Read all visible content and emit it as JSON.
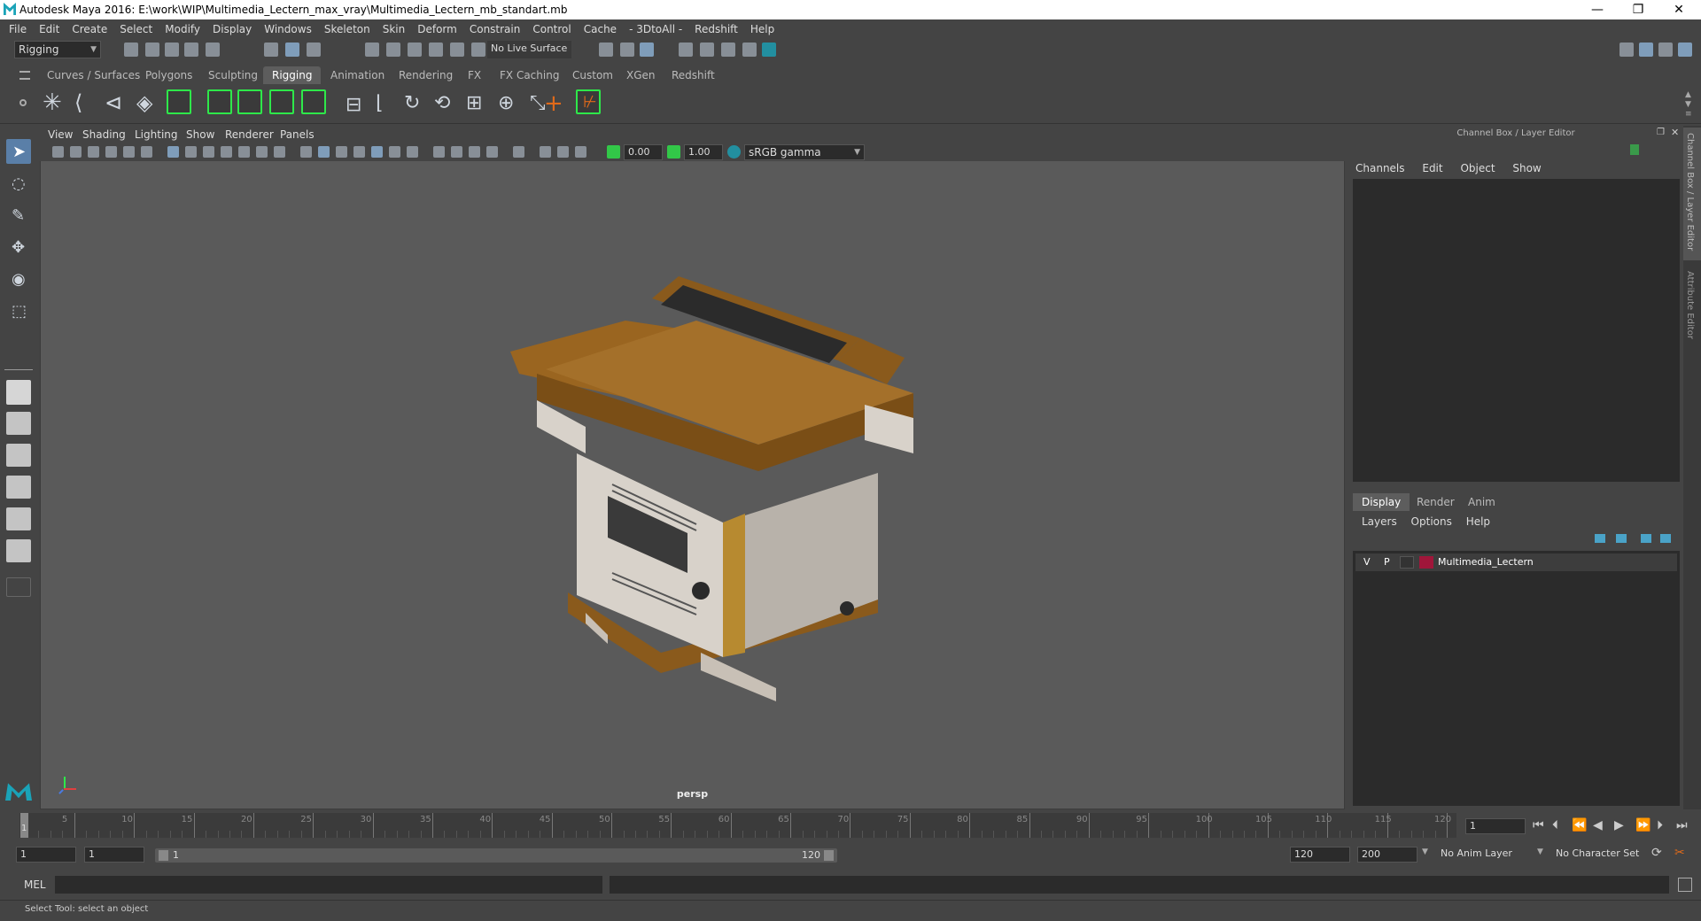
{
  "window": {
    "title": "Autodesk Maya 2016: E:\\work\\WIP\\Multimedia_Lectern_max_vray\\Multimedia_Lectern_mb_standart.mb",
    "minimize": "—",
    "restore": "❐",
    "close": "✕"
  },
  "menubar": [
    "File",
    "Edit",
    "Create",
    "Select",
    "Modify",
    "Display",
    "Windows",
    "Skeleton",
    "Skin",
    "Deform",
    "Constrain",
    "Control",
    "Cache",
    "- 3DtoAll -",
    "Redshift",
    "Help"
  ],
  "statusline": {
    "menuset": "Rigging",
    "live_surface": "No Live Surface"
  },
  "shelf_tabs": [
    {
      "label": "Curves / Surfaces",
      "active": false
    },
    {
      "label": "Polygons",
      "active": false
    },
    {
      "label": "Sculpting",
      "active": false
    },
    {
      "label": "Rigging",
      "active": true
    },
    {
      "label": "Animation",
      "active": false
    },
    {
      "label": "Rendering",
      "active": false
    },
    {
      "label": "FX",
      "active": false
    },
    {
      "label": "FX Caching",
      "active": false
    },
    {
      "label": "Custom",
      "active": false
    },
    {
      "label": "XGen",
      "active": false
    },
    {
      "label": "Redshift",
      "active": false
    }
  ],
  "viewport": {
    "menu": [
      "View",
      "Shading",
      "Lighting",
      "Show",
      "Renderer",
      "Panels"
    ],
    "exposure": "0.00",
    "gamma": "1.00",
    "color_space": "sRGB gamma",
    "camera_label": "persp"
  },
  "channel_box": {
    "title": "Channel Box / Layer Editor",
    "menu": [
      "Channels",
      "Edit",
      "Object",
      "Show"
    ]
  },
  "layer_editor": {
    "tabs": [
      {
        "label": "Display",
        "active": true
      },
      {
        "label": "Render",
        "active": false
      },
      {
        "label": "Anim",
        "active": false
      }
    ],
    "menu": [
      "Layers",
      "Options",
      "Help"
    ],
    "layers": [
      {
        "v": "V",
        "p": "P",
        "name": "Multimedia_Lectern",
        "color": "#a0163a"
      }
    ]
  },
  "side_tabs": [
    "Channel Box / Layer Editor",
    "Attribute Editor"
  ],
  "timeline": {
    "labels": [
      "5",
      "10",
      "15",
      "20",
      "25",
      "30",
      "35",
      "40",
      "45",
      "50",
      "55",
      "60",
      "65",
      "70",
      "75",
      "80",
      "85",
      "90",
      "95",
      "100",
      "105",
      "110",
      "115",
      "120"
    ],
    "start_label": "1",
    "current_frame": "1"
  },
  "range": {
    "start": "1",
    "playback_start": "1",
    "slider_start": "1",
    "slider_end": "120",
    "playback_end": "120",
    "end": "200",
    "anim_layer": "No Anim Layer",
    "character_set": "No Character Set"
  },
  "command": {
    "lang": "MEL"
  },
  "help_line": "Select Tool: select an object",
  "colors": {
    "accent_green": "#2ee84a",
    "wood": "#8a5a1c",
    "layer_color": "#a0163a"
  }
}
